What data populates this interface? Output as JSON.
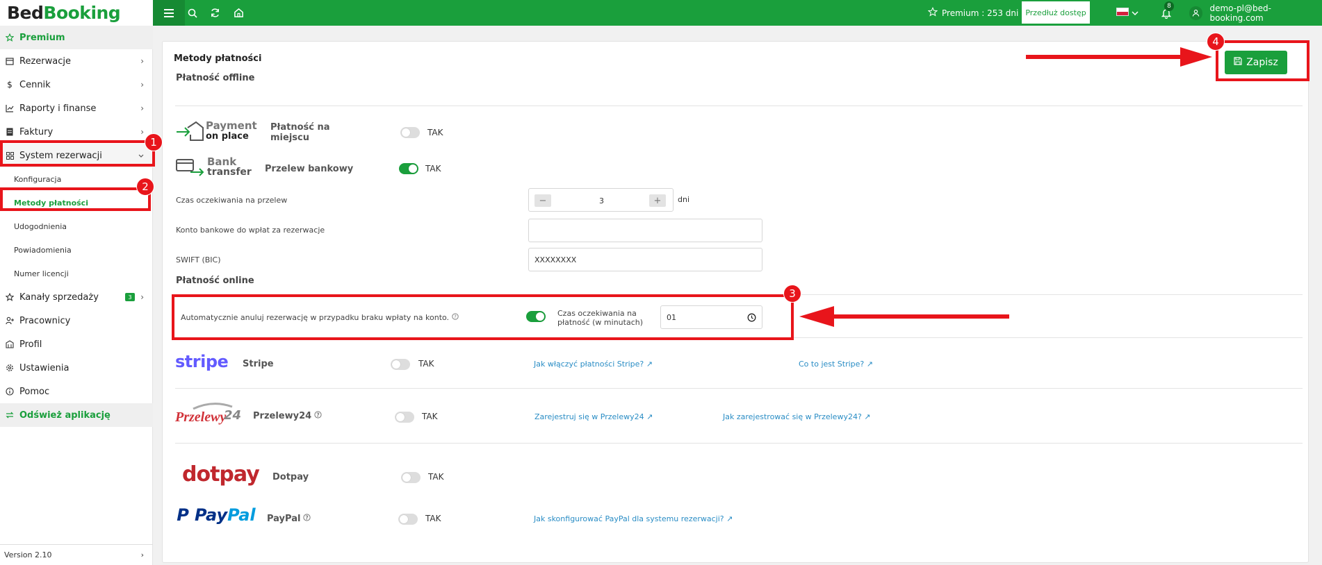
{
  "app": {
    "logo_part1": "Bed",
    "logo_part2": "Booking"
  },
  "header": {
    "premium_text": "Premium : 253 dni",
    "extend_label": "Przedłuż dostęp",
    "notifications_count": "8",
    "user_email": "demo-pl@bed-booking.com"
  },
  "sidebar": {
    "premium": "Premium",
    "items": [
      {
        "label": "Rezerwacje"
      },
      {
        "label": "Cennik"
      },
      {
        "label": "Raporty i finanse"
      },
      {
        "label": "Faktury"
      },
      {
        "label": "System rezerwacji"
      }
    ],
    "sub": [
      "Konfiguracja",
      "Metody płatności",
      "Udogodnienia",
      "Powiadomienia",
      "Numer licencji"
    ],
    "items2": [
      {
        "label": "Kanały sprzedaży",
        "badge": "3"
      },
      {
        "label": "Pracownicy"
      },
      {
        "label": "Profil"
      },
      {
        "label": "Ustawienia"
      },
      {
        "label": "Pomoc"
      }
    ],
    "refresh": "Odśwież aplikację",
    "version": "Version 2.10"
  },
  "main": {
    "title": "Metody płatności",
    "save_label": "Zapisz",
    "offline_title": "Płatność offline",
    "online_title": "Płatność online",
    "yes": "TAK",
    "pop_logo_1": "Payment",
    "pop_logo_2": "on place",
    "pop_name_1": "Płatność na",
    "pop_name_2": "miejscu",
    "bank_logo_1": "Bank",
    "bank_logo_2": "transfer",
    "bank_name": "Przelew bankowy",
    "wait_label": "Czas oczekiwania na przelew",
    "wait_value": "3",
    "wait_unit": "dni",
    "account_label": "Konto bankowe do wpłat za rezerwacje",
    "account_value": "",
    "swift_label": "SWIFT (BIC)",
    "swift_value": "XXXXXXXX",
    "auto_cancel_label": "Automatycznie anuluj rezerwację w przypadku braku wpłaty na konto.",
    "payment_wait_label_1": "Czas oczekiwania na",
    "payment_wait_label_2": "płatność (w minutach)",
    "payment_wait_value": "01",
    "stripe_logo": "stripe",
    "stripe_name": "Stripe",
    "stripe_link1": "Jak włączyć płatności Stripe?",
    "stripe_link2": "Co to jest Stripe?",
    "p24_logo": "Przelewy",
    "p24_logo_num": "24",
    "p24_name": "Przelewy24",
    "p24_link1": "Zarejestruj się w Przelewy24",
    "p24_link2": "Jak zarejestrować się w Przelewy24?",
    "dotpay_logo": "dotpay",
    "dotpay_name": "Dotpay",
    "paypal_logo_1": "Pay",
    "paypal_logo_2": "Pal",
    "paypal_name": "PayPal",
    "paypal_link": "Jak skonfigurować PayPal dla systemu rezerwacji?"
  },
  "annotations": [
    "1",
    "2",
    "3",
    "4"
  ],
  "colors": {
    "brand": "#1a9f3c",
    "annotation": "#e8151b",
    "link": "#2a8dc5"
  }
}
